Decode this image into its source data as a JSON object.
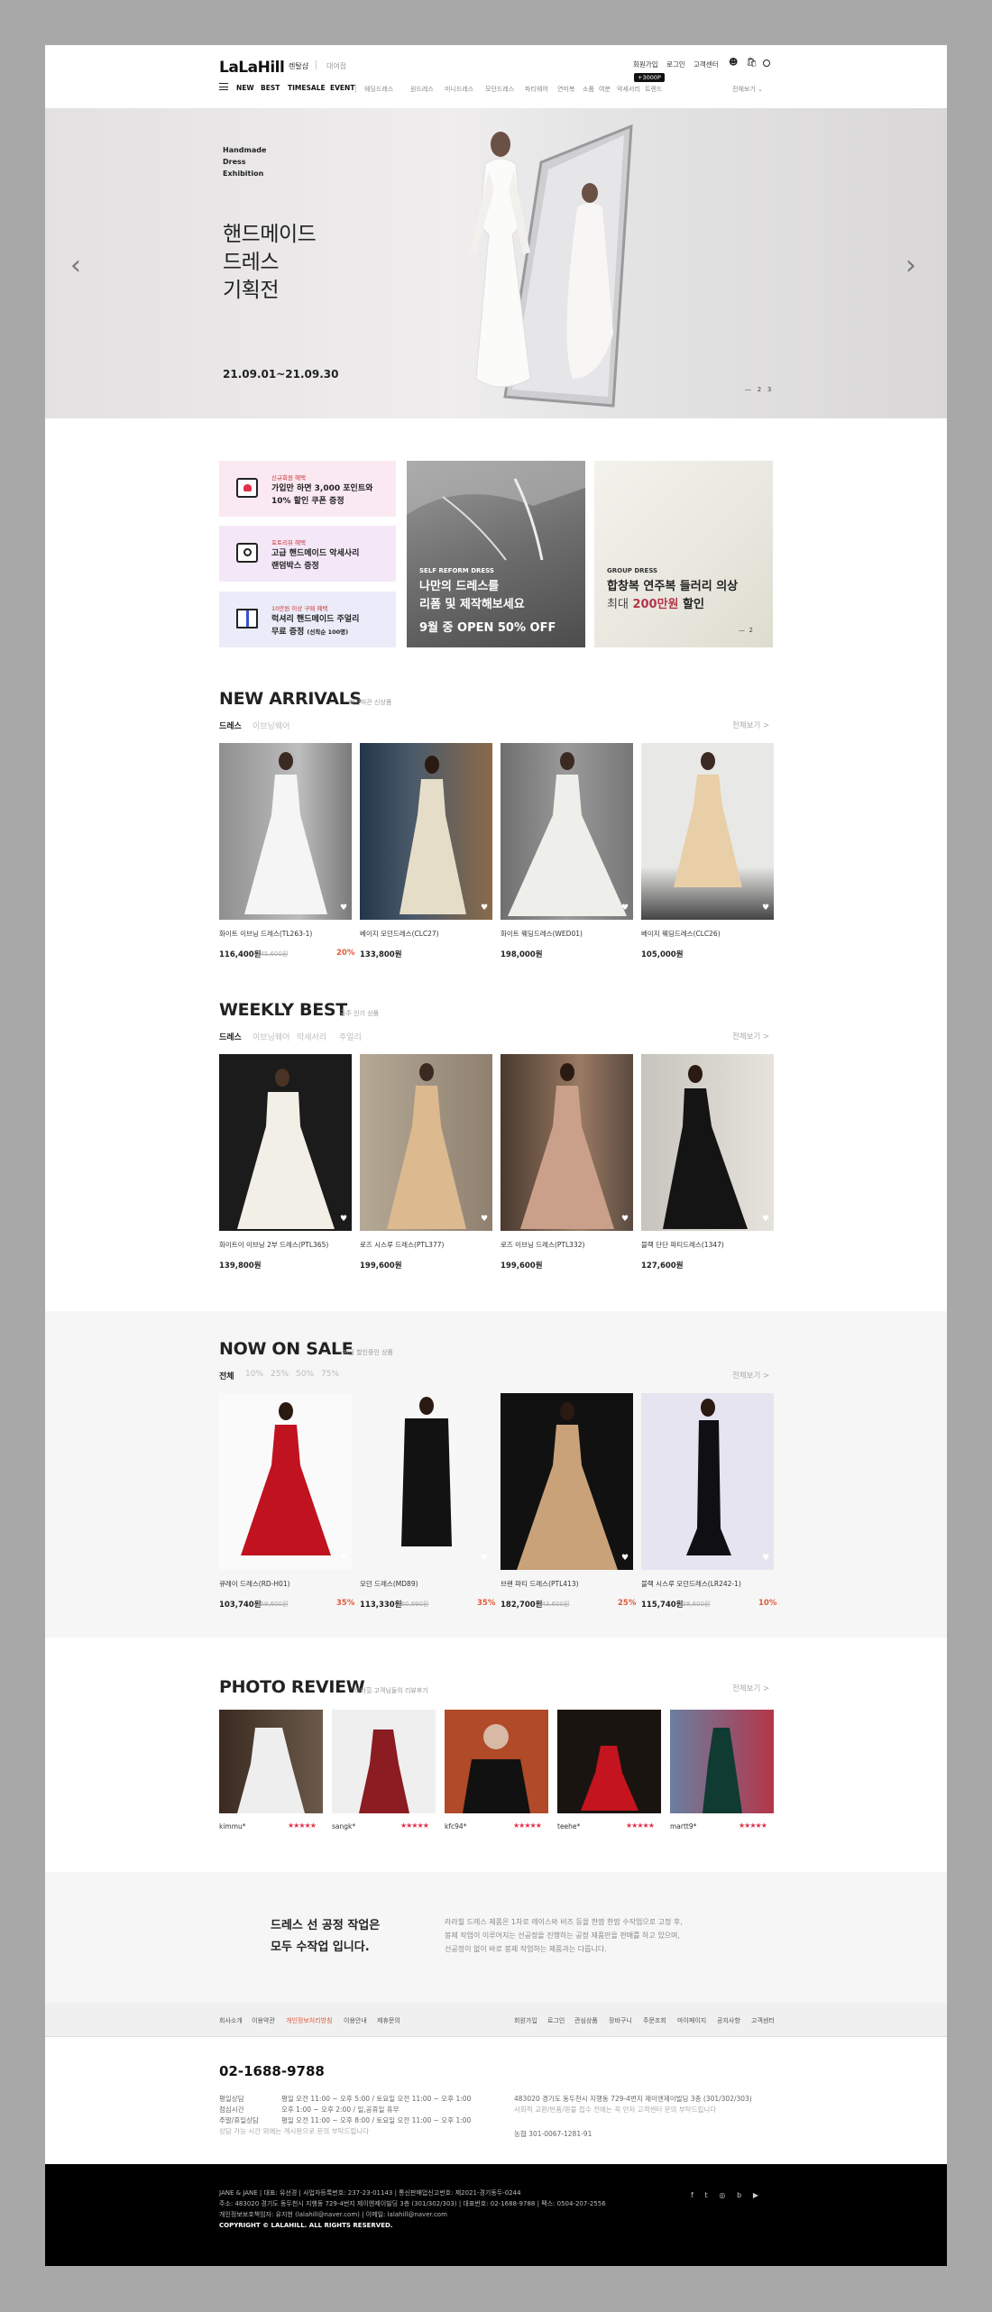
{
  "header": {
    "logo": "LaLaHill",
    "sub_current": "렌탈샵",
    "sub_other": "대여점",
    "util": [
      "회원가입",
      "로그인",
      "고객센터"
    ],
    "tooltip": "+3000P",
    "nav_main": [
      "NEW",
      "BEST",
      "TIMESALE",
      "EVENT"
    ],
    "nav_sub": [
      "웨딩드레스",
      "원드레스",
      "미니드레스",
      "모던드레스",
      "파티웨어",
      "연미복",
      "소품",
      "여분",
      "악세서리",
      "트렌드"
    ],
    "dropdown": "전체보기"
  },
  "hero": {
    "small": [
      "Handmade",
      "Dress",
      "Exhibition"
    ],
    "title": [
      "핸드메이드",
      "드레스",
      "기획전"
    ],
    "date": "21.09.01~21.09.30",
    "pager": [
      "—",
      "2",
      "3"
    ]
  },
  "promos": [
    {
      "tag": "신규회원 혜택",
      "line1": "가입만 하면 3,000 포인트와",
      "line2": "10% 할인 쿠폰 증정",
      "bg": "#fbe9f2",
      "icon": "coupon-icon"
    },
    {
      "tag": "포토리뷰 혜택",
      "line1": "고급 핸드메이드 악세사리",
      "line2": "랜덤박스 증정",
      "bg": "#f4e8f8",
      "icon": "camera-icon"
    },
    {
      "tag": "10만원 이상 구매 혜택",
      "line1": "럭셔리 핸드메이드 주얼리",
      "line2": "무료 증정",
      "line2_small": "(선착순 100명)",
      "bg": "#ebecf9",
      "icon": "gift-icon"
    }
  ],
  "banners": [
    {
      "tag": "SELF REFORM DRESS",
      "line1": "나만의 드레스를",
      "line2": "리폼 및 제작해보세요",
      "line3": "9월 중 OPEN 50% OFF"
    },
    {
      "tag": "GROUP DRESS",
      "line1": "합창복 연주복 들러리 의상",
      "line2_a": "최대",
      "line2_b": "200만원",
      "line2_c": "할인",
      "pager": [
        "—",
        "2"
      ]
    }
  ],
  "new_arrivals": {
    "title": "NEW ARRIVALS",
    "sub": "따끈따끈 신상품",
    "tabs": [
      "드레스",
      "이브닝웨어"
    ],
    "viewall": "전체보기 >",
    "items": [
      {
        "name": "화이트 이브닝 드레스(TL263-1)",
        "price": "116,400원",
        "orig": "145,600원",
        "disc": "20%"
      },
      {
        "name": "베이지 모던드레스(CLC27)",
        "price": "133,800원",
        "orig": "",
        "disc": ""
      },
      {
        "name": "화이트 웨딩드레스(WED01)",
        "price": "198,000원",
        "orig": "",
        "disc": ""
      },
      {
        "name": "베이지 웨딩드레스(CLC26)",
        "price": "105,000원",
        "orig": "",
        "disc": ""
      }
    ]
  },
  "weekly_best": {
    "title": "WEEKLY BEST",
    "sub": "금주 인기 상품",
    "tabs": [
      "드레스",
      "이브닝웨어",
      "악세서리",
      "주얼리"
    ],
    "viewall": "전체보기 >",
    "items": [
      {
        "name": "화이트이 이브닝 2부 드레스(PTL365)",
        "price": "139,800원"
      },
      {
        "name": "로즈 시스루 드레스(PTL377)",
        "price": "199,600원"
      },
      {
        "name": "로즈 이브닝 드레스(PTL332)",
        "price": "199,600원"
      },
      {
        "name": "블랙 단단 파티드레스(1347)",
        "price": "127,600원"
      }
    ]
  },
  "sale": {
    "title": "NOW ON SALE",
    "sub": "지금 할인중인 상품",
    "tabs": [
      "전체",
      "10%",
      "25%",
      "50%",
      "75%"
    ],
    "viewall": "전체보기 >",
    "items": [
      {
        "name": "큐레이 드레스(RD-H01)",
        "price": "103,740원",
        "orig": "159,600원",
        "disc": "35%"
      },
      {
        "name": "모던 드레스(MD89)",
        "price": "113,330원",
        "orig": "160,990원",
        "disc": "35%"
      },
      {
        "name": "브랜 파티 드레스(PTL413)",
        "price": "182,700원",
        "orig": "243,600원",
        "disc": "25%"
      },
      {
        "name": "블랙 시스루 모던드레스(LR242-1)",
        "price": "115,740원",
        "orig": "128,600원",
        "disc": "10%"
      }
    ]
  },
  "review": {
    "title": "PHOTO REVIEW",
    "sub": "라라힐 고객님들의 리뷰후기",
    "viewall": "전체보기 >",
    "items": [
      {
        "name": "kimmu*",
        "stars": "★★★★★"
      },
      {
        "name": "sangk*",
        "stars": "★★★★★"
      },
      {
        "name": "kfc94*",
        "stars": "★★★★★"
      },
      {
        "name": "teehe*",
        "stars": "★★★★★"
      },
      {
        "name": "martt9*",
        "stars": "★★★★★"
      }
    ]
  },
  "craft": {
    "title1": "드레스 선 공정 작업은",
    "title2": "모두 수작업 입니다.",
    "desc": [
      "라라힐 드레스 제품은 1차로 레이스와 비즈 등을 한땀 한땀 수작업으로 고정 후,",
      "봉제 작업이 이루어지는 선공정을 진행하는 공정 제품만을 판매를 하고 있으며,",
      "선공정이 없이 바로 봉제 작업하는 제품과는 다릅니다."
    ]
  },
  "footer": {
    "links_left": [
      "회사소개",
      "이용약관",
      "개인정보처리방침",
      "이용안내",
      "제휴문의"
    ],
    "links_right": [
      "회원가입",
      "로그인",
      "관심상품",
      "장바구니",
      "주문조회",
      "마이페이지",
      "공지사항",
      "고객센터"
    ],
    "phone": "02-1688-9788",
    "hours_labels": [
      "평일상담",
      "점심시간",
      "주말/휴일상담"
    ],
    "hours": [
      "평일 오전 11:00 ~ 오후 5:00 / 토요일 오전 11:00 ~ 오후 1:00",
      "오후 1:00 ~ 오후 2:00 / 일,공휴일 휴무",
      "평일 오전 11:00 ~ 오후 8:00 / 토요일 오전 11:00 ~ 오후 1:00"
    ],
    "hours_note": "상담 가능 시간 외에는 게시판으로 문의 부탁드립니다",
    "addr": [
      "483020 경기도 동두천시 지행동 729-4번지 제이엔제이빌딩 3층 (301/302/303)",
      "사회적 교환/반품/환불 접수 전에는 꼭 먼저 고객센터 문의 부탁드립니다"
    ],
    "bank": "농협 301-0067-1281-91",
    "black_lines": [
      "JANE & JANE    |    대표: 유선경    |    사업자등록번호: 237-23-01143    |    통신판매업신고번호: 제2021-경기동두-0244",
      "주소: 483020 경기도 동두천시 지행동 729-4번지 제이엔제이빌딩 3층 (301/302/303)    |    대표번호: 02-1688-9788    |    팩스: 0504-207-2556",
      "개인정보보호책임자: 유지현 (lalahill@naver.com)    |    이메일: lalahill@naver.com"
    ],
    "copyright": "COPYRIGHT © LALAHILL. ALL RIGHTS RESERVED.",
    "sns": [
      "f",
      "t",
      "◎",
      "b",
      "▶"
    ]
  }
}
